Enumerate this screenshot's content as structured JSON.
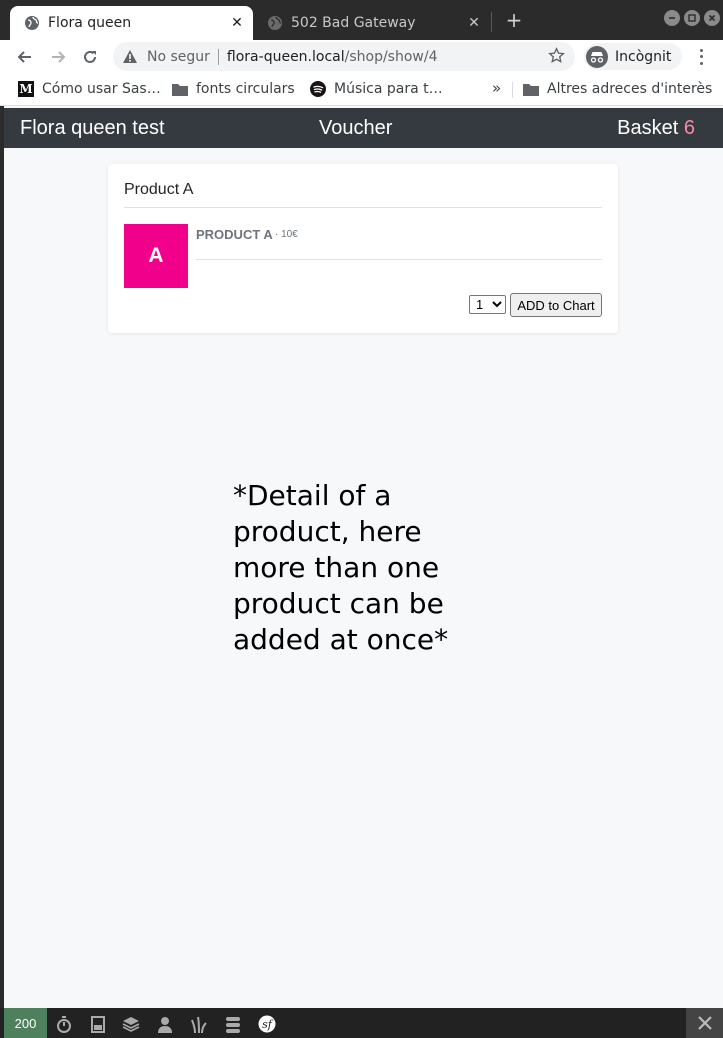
{
  "browser": {
    "tabs": [
      {
        "title": "Flora queen",
        "active": true
      },
      {
        "title": "502 Bad Gateway",
        "active": false
      }
    ],
    "security_label": "No segur",
    "url_host": "flora-queen.local",
    "url_path": "/shop/show/4",
    "profile_label": "Incògnit",
    "bookmarks": [
      {
        "label": "Cómo usar Sas…",
        "icon": "medium-icon"
      },
      {
        "label": "fonts circulars",
        "icon": "folder-icon"
      },
      {
        "label": "Música para t…",
        "icon": "spotify-icon"
      }
    ],
    "bookmarks_overflow": "»",
    "other_bookmarks": "Altres adreces d'interès"
  },
  "navbar": {
    "brand": "Flora queen test",
    "voucher": "Voucher",
    "basket_label": "Basket",
    "basket_count": "6"
  },
  "product_card": {
    "title": "Product A",
    "thumb_letter": "A",
    "product_name": "PRODUCT A",
    "price": "· 10€",
    "quantity_selected": "1",
    "add_button": "ADD to Chart"
  },
  "annotation": "*Detail of a product, here more than one product can be added at once*",
  "debug_toolbar": {
    "status_code": "200",
    "icons": [
      "timer-icon",
      "memory-icon",
      "layers-icon",
      "user-icon",
      "twig-icon",
      "database-icon",
      "symfony-icon"
    ]
  },
  "colors": {
    "navbar_bg": "#343a40",
    "basket_count": "#f58aa2",
    "thumb_bg": "#f1008c",
    "status_ok": "#4f805d"
  }
}
